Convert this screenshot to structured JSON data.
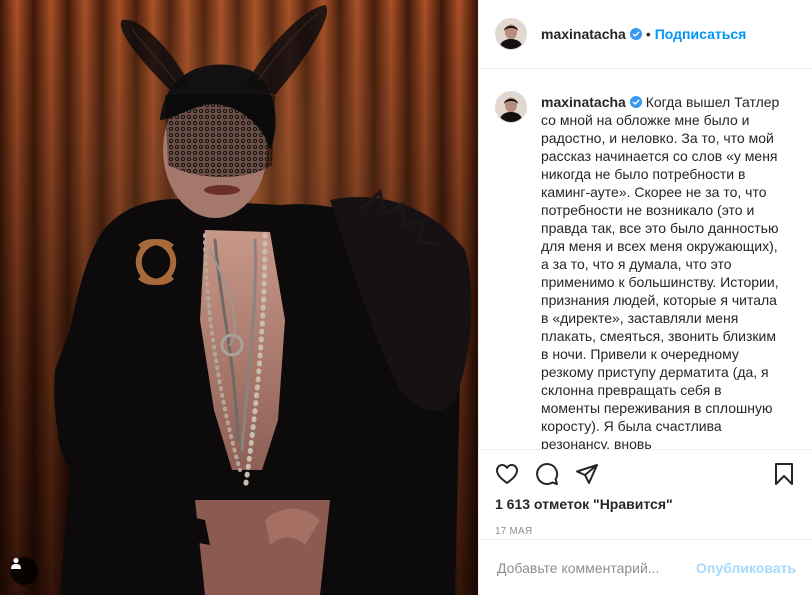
{
  "post": {
    "username": "maxinatacha",
    "follow_label": "Подписаться",
    "dot_separator": "•",
    "caption": "Когда вышел Татлер со мной на обложке мне было и радостно, и неловко. За то, что мой рассказ начинается со слов «у меня никогда не было потребности в каминг-ауте». Скорее не за то, что потребности не возникало (это и правда так, все это было данностью для меня и всех меня окружающих), а за то, что я думала, что это применимо к большинству. Истории, признания людей, которые я читала в «директе», заставляли меня плакать, смеяться, звонить близким в ночи. Привели к очередному резкому приступу дерматита (да, я склонна превращать себя в моменты переживания в сплошную коросту). Я была счастлива резонансу, вновь",
    "likes_text": "1 613 отметок \"Нравится\"",
    "date": "17 мая"
  },
  "icons": {
    "like": "heart-icon",
    "comment": "comment-icon",
    "share": "paper-plane-icon",
    "save": "bookmark-icon",
    "verified": "verified-badge-icon",
    "tag": "user-tag-icon"
  },
  "comment_box": {
    "placeholder": "Добавьте комментарий...",
    "publish_label": "Опубликовать"
  },
  "colors": {
    "accent": "#0095f6",
    "text": "#262626",
    "muted": "#8e8e8e",
    "border": "#efefef"
  }
}
